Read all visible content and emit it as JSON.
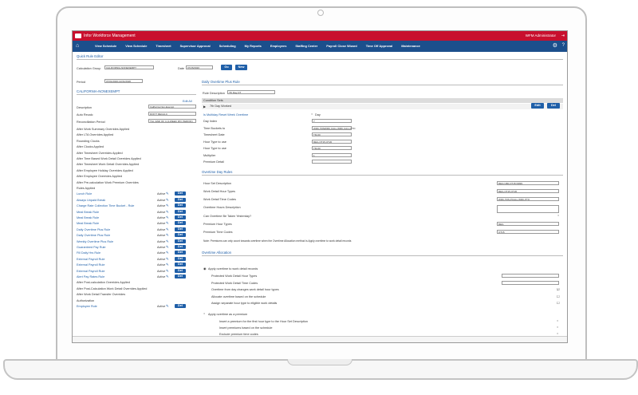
{
  "app": {
    "title": "Infor Workforce Management",
    "user": "WFM Administrator"
  },
  "nav": {
    "items": [
      "View Schedule",
      "View Schedule",
      "Timesheet",
      "Supervisor Approval",
      "Scheduling",
      "My Reports",
      "Employees",
      "Staffing Center",
      "Payroll Close Wizard",
      "Time Off Approval",
      "Maintenance"
    ]
  },
  "editor": {
    "title": "Quick Rule Editor",
    "group_label": "Calculation Group",
    "group_value": "CALIFORNIA-NONEXEMPT",
    "date_label": "Date",
    "date_value": "07/26/2020",
    "go": "Go",
    "new": "New",
    "period_label": "Period",
    "period_value": "07/01/2020-12/31/2020"
  },
  "left": {
    "title": "CALIFORNIA-NONEXEMPT",
    "edit_all": "Edit All",
    "desc_label": "Description",
    "desc_value": "California Non-Exempt",
    "auto_label": "Auto Recalc",
    "auto_value": "DON'T RECALC",
    "reconcile_label": "Reconciliation Period",
    "reconcile_value": "TILL END OF 4 (4-WEEK PAY PERIOD)",
    "static": [
      "After Work Summary Overrides Applied",
      "After LTA Overrides Applied",
      "Rounding Clocks",
      "After Clocks Applied",
      "After Timesheet Overrides Applied",
      "After Time Based Work Detail Overrides Applied",
      "After Timesheet Work Detail Overrides Applied",
      "After Employee Holiday Overrides Applied",
      "After Employee Overrides Applied",
      "After Pre-calculation Work Premium Overrides",
      "Rules Applied"
    ],
    "rules": [
      "Lunch Rule",
      "Always Unpaid Break",
      "Charge Rate Collection Time Bucket - Rule",
      "Meal Break Rule",
      "Meal Break Rule",
      "Meal Break Rule",
      "Daily Overtime Plus Rule",
      "Daily Overtime Plus Rule",
      "Weekly Overtime Plus Rule",
      "Guaranteed Pay Rule",
      "Fill Daily Hrs Rule",
      "External Payroll Rule",
      "External Payroll Rule",
      "External Payroll Rule",
      "Alert Pay Rates Rule"
    ],
    "static2": [
      "After Post-calculation Overrides Applied",
      "After Post-Calculation Work Detail Overrides Applied",
      "After Work Detail Transfer Overrides",
      "Authorization"
    ],
    "last_rule": "Employee Rule",
    "active": "Active",
    "del": "Del"
  },
  "right": {
    "title": "Daily Overtime Plus Rule",
    "rule_desc_label": "Rule Description",
    "rule_desc_value": "7th Day OT",
    "cond_header": "Condition Sets",
    "cond_item": "7th Day Worked",
    "edit": "Edit",
    "del": "Del",
    "calc_link": "Is Multiday Reset Week Overtime",
    "calc_right": "Day",
    "fields": [
      {
        "label": "Day Index",
        "value": "7"
      },
      {
        "label": "Time Buckets to",
        "value": "WRK,TRNWRK,CALL,WRK,CALL,PTO"
      },
      {
        "label": "Timesheet Date",
        "value": "TM-60"
      },
      {
        "label": "Hour Type to use",
        "value": "REG,OT15,OT20"
      },
      {
        "label": "Hour Type to use",
        "value": "TM-60"
      },
      {
        "label": "Multiplier",
        "value": "1"
      },
      {
        "label": "Premium Detail",
        "value": ""
      }
    ],
    "od_title": "Overtime Day Rules",
    "od_fields": [
      {
        "label": "Hour Set Description",
        "value": "REG=480,OT15=9999"
      },
      {
        "label": "Work Detail Hour Types",
        "value": "REG,OT15,OT20"
      },
      {
        "label": "Work Detail Time Codes",
        "value": "WRK,TRN,PCALL,WRK,PTO"
      },
      {
        "label": "Overtime Hours Description",
        "value": ""
      },
      {
        "label": "Can Overtime Be Taken Yesterday?",
        "value": ""
      },
      {
        "label": "Premium Hour Types",
        "value": "REG"
      },
      {
        "label": "Premium Time Codes",
        "value": "OT15"
      }
    ],
    "note": "Note: Premiums can only count towards overtime when the Overtime Allocation method is Apply overtime to work detail records",
    "alloc_title": "Overtime Allocation",
    "alloc_opt1": "Apply overtime to work detail records",
    "alloc_rows": [
      "Protected Work Detail Hour Types",
      "Protected Work Detail Time Codes",
      "Overtime from day changes work detail hour types",
      "Allocate overtime based on the schedule",
      "Assign separate hour type to eligible work details"
    ],
    "alloc_opt2": "Apply overtime as a premium",
    "prem_rows": [
      "Insert a premium for the first hour type to the Hour Set Description",
      "Insert premiums based on the schedule",
      "Exclude premium time codes"
    ]
  }
}
